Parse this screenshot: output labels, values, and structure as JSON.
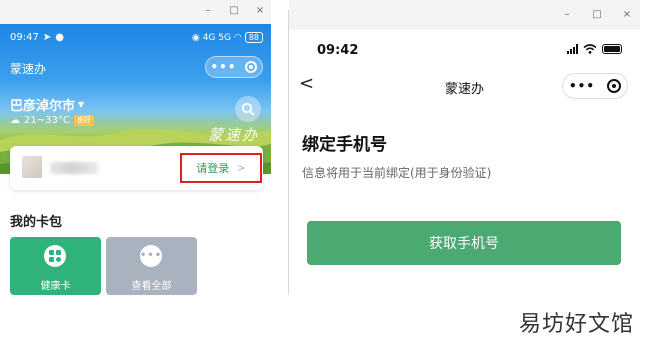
{
  "window_controls": {
    "minimize": "–",
    "maximize": "□",
    "close": "×"
  },
  "left": {
    "status": {
      "time": "09:47",
      "signal": "4G 5G",
      "battery": "88"
    },
    "app_title": "蒙速办",
    "capsule": {
      "more": "•••"
    },
    "city": "巴彦淖尔市",
    "weather": {
      "temp": "21~33°C",
      "aqi": "良好"
    },
    "calligraphy": "蒙速办",
    "login": {
      "label": "请登录",
      "chevron": ">"
    },
    "wallet_title": "我的卡包",
    "tiles": [
      {
        "label": "健康卡",
        "color": "#2fb37a",
        "icon": "health-card-icon"
      },
      {
        "label": "查看全部",
        "color": "#a9b3c0",
        "icon": "more-dots-icon"
      }
    ]
  },
  "right": {
    "status_time": "09:42",
    "back": "<",
    "nav_title": "蒙速办",
    "capsule": {
      "more": "•••"
    },
    "bind_title": "绑定手机号",
    "bind_subtitle": "信息将用于当前绑定(用于身份验证)",
    "button_label": "获取手机号",
    "accent": "#4aaa72"
  },
  "watermark": "易坊好文馆"
}
